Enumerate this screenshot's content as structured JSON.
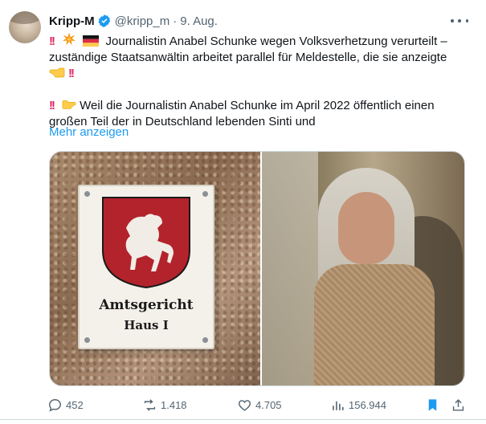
{
  "author": {
    "name": "Kripp-M",
    "handle": "@kripp_m",
    "separator": "·",
    "date": "9. Aug."
  },
  "tweet": {
    "line1": "Journalistin Anabel Schunke wegen Volksverhetzung verurteilt –",
    "line2": "zuständige Staatsanwältin arbeitet parallel für Meldestelle, die sie anzeigte",
    "line4": "Weil die Journalistin Anabel Schunke im April 2022 öffentlich einen",
    "line5": "großen Teil der in Deutschland lebenden Sinti und",
    "show_more": "Mehr anzeigen"
  },
  "media": {
    "left_image": {
      "sign_line1": "Amtsgericht",
      "sign_line2": "Haus I"
    }
  },
  "actions": {
    "replies": "452",
    "reposts": "1.418",
    "likes": "4.705",
    "views": "156.944"
  },
  "colors": {
    "accent": "#1d9bf0",
    "muted_text": "#536471",
    "border": "#cfd9de"
  },
  "icons": [
    "verified-badge-icon",
    "more-icon",
    "double-exclamation-icon",
    "explosion-icon",
    "german-flag-icon",
    "pointing-hand-left-icon",
    "pointing-hand-right-icon",
    "reply-icon",
    "repost-icon",
    "like-icon",
    "views-icon",
    "bookmark-icon",
    "share-icon"
  ]
}
